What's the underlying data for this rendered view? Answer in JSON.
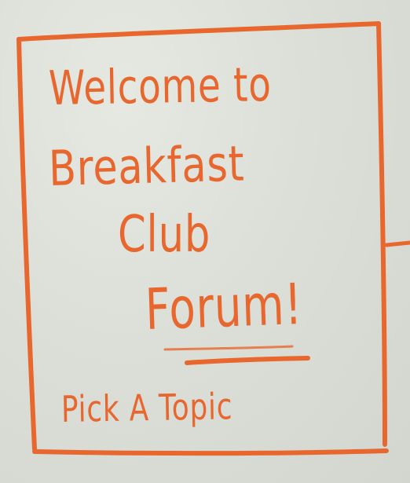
{
  "sign": {
    "line1": "Welcome to",
    "line2": "Breakfast",
    "line3": "Club",
    "line4": "Forum!",
    "line5": "Pick A Topic"
  },
  "colors": {
    "marker": "#e8672e",
    "board": "#dcdfd8"
  }
}
